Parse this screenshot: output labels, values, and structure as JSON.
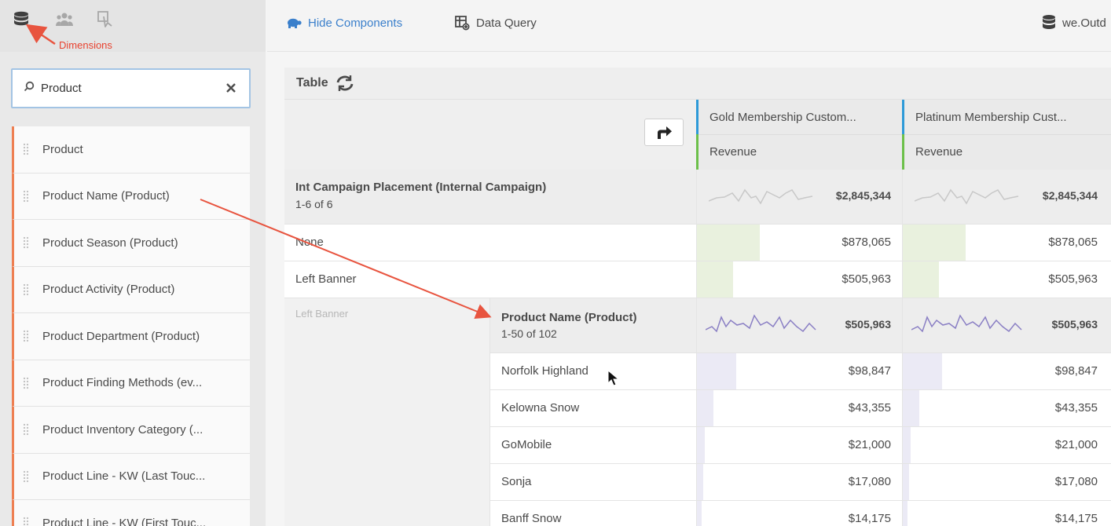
{
  "left_rail": {
    "icons": [
      "dimensions-icon",
      "metrics-icon",
      "segments-icon"
    ],
    "annotation": "Dimensions",
    "search": {
      "value": "Product",
      "placeholder": ""
    },
    "dimensions": [
      "Product",
      "Product Name (Product)",
      "Product Season (Product)",
      "Product Activity (Product)",
      "Product Department (Product)",
      "Product Finding Methods (ev...",
      "Product Inventory Category (...",
      "Product Line - KW (Last Touc...",
      "Product Line - KW (First Touc..."
    ]
  },
  "toolbar": {
    "hide_components": "Hide Components",
    "data_query": "Data Query",
    "report_suite": "we.Outd"
  },
  "table": {
    "title": "Table",
    "columns": [
      {
        "segment": "Gold Membership Custom...",
        "metric": "Revenue"
      },
      {
        "segment": "Platinum Membership Cust...",
        "metric": "Revenue"
      }
    ],
    "dimension_header": {
      "name": "Int Campaign Placement (Internal Campaign)",
      "count": "1-6 of 6",
      "totals": [
        "$2,845,344",
        "$2,845,344"
      ]
    },
    "rows": [
      {
        "label": "None",
        "values": [
          "$878,065",
          "$878,065"
        ],
        "share": 0.31
      },
      {
        "label": "Left Banner",
        "values": [
          "$505,963",
          "$505,963"
        ],
        "share": 0.18
      }
    ],
    "breakdown": {
      "parent_label": "Left Banner",
      "name": "Product Name (Product)",
      "count": "1-50 of 102",
      "totals": [
        "$505,963",
        "$505,963"
      ],
      "rows": [
        {
          "label": "Norfolk Highland",
          "values": [
            "$98,847",
            "$98,847"
          ],
          "share": 0.195
        },
        {
          "label": "Kelowna Snow",
          "values": [
            "$43,355",
            "$43,355"
          ],
          "share": 0.086
        },
        {
          "label": "GoMobile",
          "values": [
            "$21,000",
            "$21,000"
          ],
          "share": 0.042
        },
        {
          "label": "Sonja",
          "values": [
            "$17,080",
            "$17,080"
          ],
          "share": 0.034
        },
        {
          "label": "Banff Snow",
          "values": [
            "$14,175",
            "$14,175"
          ],
          "share": 0.028
        }
      ]
    }
  },
  "colors": {
    "accent": "#3a7fcb",
    "annotation": "#e8422f",
    "segment_bar": "#2d9ad8",
    "metric_bar": "#6cc04a",
    "dimension_stripe": "#ee7f52"
  }
}
